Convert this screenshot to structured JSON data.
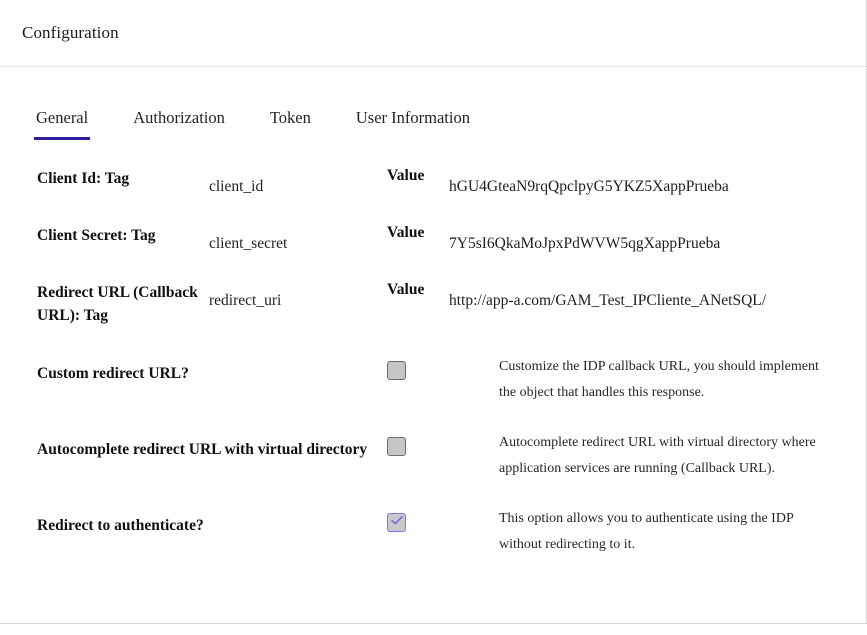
{
  "header": {
    "title": "Configuration"
  },
  "tabs": [
    {
      "label": "General",
      "active": true
    },
    {
      "label": "Authorization",
      "active": false
    },
    {
      "label": "Token",
      "active": false
    },
    {
      "label": "User Information",
      "active": false
    }
  ],
  "fields": [
    {
      "label": "Client Id: Tag",
      "tag": "client_id",
      "value_label": "Value",
      "value": "hGU4GteaN9rqQpclpyG5YKZ5XappPrueba"
    },
    {
      "label": "Client Secret: Tag",
      "tag": "client_secret",
      "value_label": "Value",
      "value": "7Y5sI6QkaMoJpxPdWVW5qgXappPrueba"
    },
    {
      "label": "Redirect URL (Callback URL): Tag",
      "tag": "redirect_uri",
      "value_label": "Value",
      "value": "http://app-a.com/GAM_Test_IPCliente_ANetSQL/"
    }
  ],
  "options": [
    {
      "label": "Custom redirect URL?",
      "checked": false,
      "help": "Customize the IDP callback URL, you should implement the object that handles this response."
    },
    {
      "label": "Autocomplete redirect URL with virtual directory",
      "checked": false,
      "help": "Autocomplete redirect URL with virtual directory where application services are running (Callback URL)."
    },
    {
      "label": "Redirect to authenticate?",
      "checked": true,
      "help": "This option allows you to authenticate using the IDP without redirecting to it."
    }
  ],
  "colors": {
    "accent": "#2b1fa0",
    "checkbox_checked_border": "#7b78e8",
    "checkbox_fill": "#c6c6c6",
    "divider": "#e6e6e6"
  },
  "icons": {
    "check": "check-icon"
  }
}
